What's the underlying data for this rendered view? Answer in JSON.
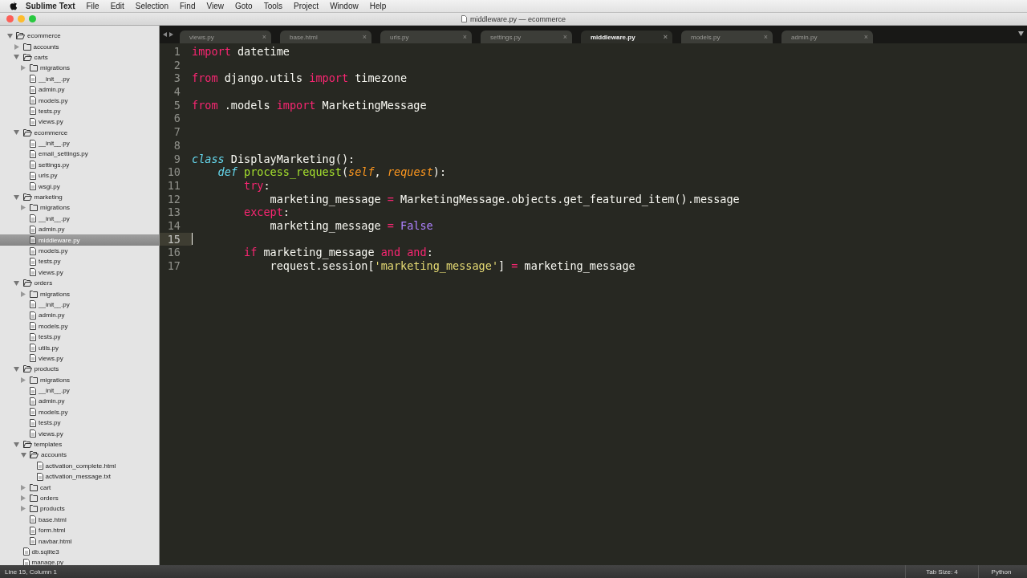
{
  "menu_bar": {
    "app_name": "Sublime Text",
    "items": [
      "File",
      "Edit",
      "Selection",
      "Find",
      "View",
      "Goto",
      "Tools",
      "Project",
      "Window",
      "Help"
    ]
  },
  "window": {
    "title": "middleware.py — ecommerce"
  },
  "tree": [
    {
      "name": "ecommerce",
      "kind": "folder",
      "expanded": true,
      "selected": false,
      "children": [
        {
          "name": "accounts",
          "kind": "folder",
          "expanded": false,
          "selected": false
        },
        {
          "name": "carts",
          "kind": "folder",
          "expanded": true,
          "selected": false,
          "children": [
            {
              "name": "migrations",
              "kind": "folder",
              "expanded": false,
              "selected": false
            },
            {
              "name": "__init__.py",
              "kind": "file",
              "selected": false
            },
            {
              "name": "admin.py",
              "kind": "file",
              "selected": false
            },
            {
              "name": "models.py",
              "kind": "file",
              "selected": false
            },
            {
              "name": "tests.py",
              "kind": "file",
              "selected": false
            },
            {
              "name": "views.py",
              "kind": "file",
              "selected": false
            }
          ]
        },
        {
          "name": "ecommerce",
          "kind": "folder",
          "expanded": true,
          "selected": false,
          "children": [
            {
              "name": "__init__.py",
              "kind": "file",
              "selected": false
            },
            {
              "name": "email_settings.py",
              "kind": "file",
              "selected": false
            },
            {
              "name": "settings.py",
              "kind": "file",
              "selected": false
            },
            {
              "name": "urls.py",
              "kind": "file",
              "selected": false
            },
            {
              "name": "wsgi.py",
              "kind": "file",
              "selected": false
            }
          ]
        },
        {
          "name": "marketing",
          "kind": "folder",
          "expanded": true,
          "selected": false,
          "children": [
            {
              "name": "migrations",
              "kind": "folder",
              "expanded": false,
              "selected": false
            },
            {
              "name": "__init__.py",
              "kind": "file",
              "selected": false
            },
            {
              "name": "admin.py",
              "kind": "file",
              "selected": false
            },
            {
              "name": "middleware.py",
              "kind": "file",
              "selected": true
            },
            {
              "name": "models.py",
              "kind": "file",
              "selected": false
            },
            {
              "name": "tests.py",
              "kind": "file",
              "selected": false
            },
            {
              "name": "views.py",
              "kind": "file",
              "selected": false
            }
          ]
        },
        {
          "name": "orders",
          "kind": "folder",
          "expanded": true,
          "selected": false,
          "children": [
            {
              "name": "migrations",
              "kind": "folder",
              "expanded": false,
              "selected": false
            },
            {
              "name": "__init__.py",
              "kind": "file",
              "selected": false
            },
            {
              "name": "admin.py",
              "kind": "file",
              "selected": false
            },
            {
              "name": "models.py",
              "kind": "file",
              "selected": false
            },
            {
              "name": "tests.py",
              "kind": "file",
              "selected": false
            },
            {
              "name": "utils.py",
              "kind": "file",
              "selected": false
            },
            {
              "name": "views.py",
              "kind": "file",
              "selected": false
            }
          ]
        },
        {
          "name": "products",
          "kind": "folder",
          "expanded": true,
          "selected": false,
          "children": [
            {
              "name": "migrations",
              "kind": "folder",
              "expanded": false,
              "selected": false
            },
            {
              "name": "__init__.py",
              "kind": "file",
              "selected": false
            },
            {
              "name": "admin.py",
              "kind": "file",
              "selected": false
            },
            {
              "name": "models.py",
              "kind": "file",
              "selected": false
            },
            {
              "name": "tests.py",
              "kind": "file",
              "selected": false
            },
            {
              "name": "views.py",
              "kind": "file",
              "selected": false
            }
          ]
        },
        {
          "name": "templates",
          "kind": "folder",
          "expanded": true,
          "selected": false,
          "children": [
            {
              "name": "accounts",
              "kind": "folder",
              "expanded": true,
              "selected": false,
              "children": [
                {
                  "name": "activation_complete.html",
                  "kind": "file",
                  "selected": false
                },
                {
                  "name": "activation_message.txt",
                  "kind": "file",
                  "selected": false
                }
              ]
            },
            {
              "name": "cart",
              "kind": "folder",
              "expanded": false,
              "selected": false
            },
            {
              "name": "orders",
              "kind": "folder",
              "expanded": false,
              "selected": false
            },
            {
              "name": "products",
              "kind": "folder",
              "expanded": false,
              "selected": false
            },
            {
              "name": "base.html",
              "kind": "file",
              "selected": false
            },
            {
              "name": "form.html",
              "kind": "file",
              "selected": false
            },
            {
              "name": "navbar.html",
              "kind": "file",
              "selected": false
            }
          ]
        },
        {
          "name": "db.sqlite3",
          "kind": "file",
          "selected": false
        },
        {
          "name": "manage.py",
          "kind": "file",
          "selected": false
        }
      ]
    }
  ],
  "tabs": [
    {
      "label": "views.py",
      "selected": false
    },
    {
      "label": "base.html",
      "selected": false
    },
    {
      "label": "urls.py",
      "selected": false
    },
    {
      "label": "settings.py",
      "selected": false
    },
    {
      "label": "middleware.py",
      "selected": true
    },
    {
      "label": "models.py",
      "selected": false
    },
    {
      "label": "admin.py",
      "selected": false
    }
  ],
  "tab_close": "×",
  "code": [
    {
      "number": "1",
      "current": false,
      "tokens": [
        {
          "kind": "keyword",
          "text": "import"
        },
        {
          "kind": "plain",
          "text": " datetime"
        }
      ]
    },
    {
      "number": "2",
      "current": false
    },
    {
      "number": "3",
      "current": false,
      "tokens": [
        {
          "kind": "keyword",
          "text": "from"
        },
        {
          "kind": "plain",
          "text": " django.utils "
        },
        {
          "kind": "keyword",
          "text": "import"
        },
        {
          "kind": "plain",
          "text": " timezone"
        }
      ]
    },
    {
      "number": "4",
      "current": false
    },
    {
      "number": "5",
      "current": false,
      "tokens": [
        {
          "kind": "keyword",
          "text": "from"
        },
        {
          "kind": "plain",
          "text": " .models "
        },
        {
          "kind": "keyword",
          "text": "import"
        },
        {
          "kind": "plain",
          "text": " MarketingMessage"
        }
      ]
    },
    {
      "number": "6",
      "current": false
    },
    {
      "number": "7",
      "current": false
    },
    {
      "number": "8",
      "current": false
    },
    {
      "number": "9",
      "current": false,
      "tokens": [
        {
          "kind": "storage",
          "text": "class"
        },
        {
          "kind": "plain",
          "text": " DisplayMarketing():"
        }
      ]
    },
    {
      "number": "10",
      "current": false,
      "tokens": [
        {
          "kind": "storage",
          "text": "    def "
        },
        {
          "kind": "function",
          "text": "process_request"
        },
        {
          "kind": "plain",
          "text": "("
        },
        {
          "kind": "parameter",
          "text": "self"
        },
        {
          "kind": "plain",
          "text": ", "
        },
        {
          "kind": "parameter",
          "text": "request"
        },
        {
          "kind": "plain",
          "text": "):"
        }
      ]
    },
    {
      "number": "11",
      "current": false,
      "tokens": [
        {
          "kind": "keyword",
          "text": "        try"
        },
        {
          "kind": "plain",
          "text": ":"
        }
      ]
    },
    {
      "number": "12",
      "current": false,
      "tokens": [
        {
          "kind": "plain",
          "text": "            marketing_message "
        },
        {
          "kind": "keyword",
          "text": "="
        },
        {
          "kind": "plain",
          "text": " MarketingMessage.objects.get_featured_item().message"
        }
      ]
    },
    {
      "number": "13",
      "current": false,
      "tokens": [
        {
          "kind": "keyword",
          "text": "        except"
        },
        {
          "kind": "plain",
          "text": ":"
        }
      ]
    },
    {
      "number": "14",
      "current": false,
      "tokens": [
        {
          "kind": "plain",
          "text": "            marketing_message "
        },
        {
          "kind": "keyword",
          "text": "= "
        },
        {
          "kind": "constant",
          "text": "False"
        }
      ]
    },
    {
      "number": "15",
      "current": true
    },
    {
      "number": "16",
      "current": false,
      "tokens": [
        {
          "kind": "keyword",
          "text": "        if"
        },
        {
          "kind": "plain",
          "text": " marketing_message "
        },
        {
          "kind": "keyword",
          "text": "and and"
        },
        {
          "kind": "plain",
          "text": ":"
        }
      ]
    },
    {
      "number": "17",
      "current": false,
      "tokens": [
        {
          "kind": "plain",
          "text": "            request.session["
        },
        {
          "kind": "string",
          "text": "'marketing_message'"
        },
        {
          "kind": "plain",
          "text": "] "
        },
        {
          "kind": "keyword",
          "text": "="
        },
        {
          "kind": "plain",
          "text": " marketing_message"
        }
      ]
    }
  ],
  "status_bar": {
    "position": "Line 15, Column 1",
    "tab_size": "Tab Size: 4",
    "syntax": "Python"
  }
}
